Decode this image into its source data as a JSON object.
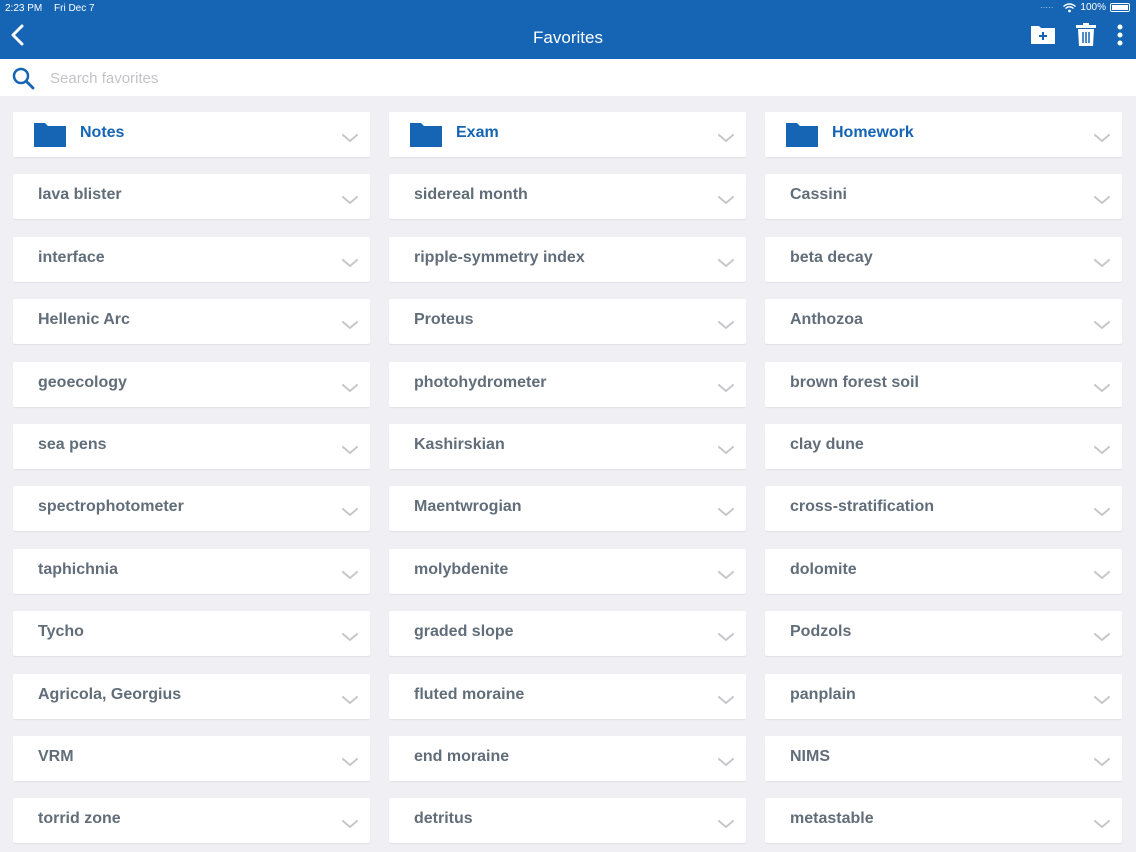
{
  "status_bar": {
    "time": "2:23 PM",
    "date": "Fri Dec 7",
    "battery": "100%"
  },
  "header": {
    "title": "Favorites"
  },
  "search": {
    "placeholder": "Search favorites"
  },
  "colors": {
    "brand": "#1565b4",
    "item_text": "#616e7a",
    "background": "#efeff4"
  },
  "icons": [
    "back-icon",
    "new-folder-icon",
    "trash-icon",
    "more-icon",
    "search-icon",
    "folder-icon",
    "chevron-down-icon"
  ],
  "columns": [
    {
      "folder": "Notes",
      "items": [
        "lava blister",
        "interface",
        "Hellenic Arc",
        "geoecology",
        "sea pens",
        "spectrophotometer",
        "taphichnia",
        "Tycho",
        "Agricola, Georgius",
        "VRM",
        "torrid zone"
      ]
    },
    {
      "folder": "Exam",
      "items": [
        "sidereal month",
        "ripple-symmetry index",
        "Proteus",
        "photohydrometer",
        "Kashirskian",
        "Maentwrogian",
        "molybdenite",
        "graded slope",
        "fluted moraine",
        "end moraine",
        "detritus"
      ]
    },
    {
      "folder": "Homework",
      "items": [
        "Cassini",
        "beta decay",
        "Anthozoa",
        "brown forest soil",
        "clay dune",
        "cross-stratification",
        "dolomite",
        "Podzols",
        "panplain",
        "NIMS",
        "metastable"
      ]
    }
  ]
}
